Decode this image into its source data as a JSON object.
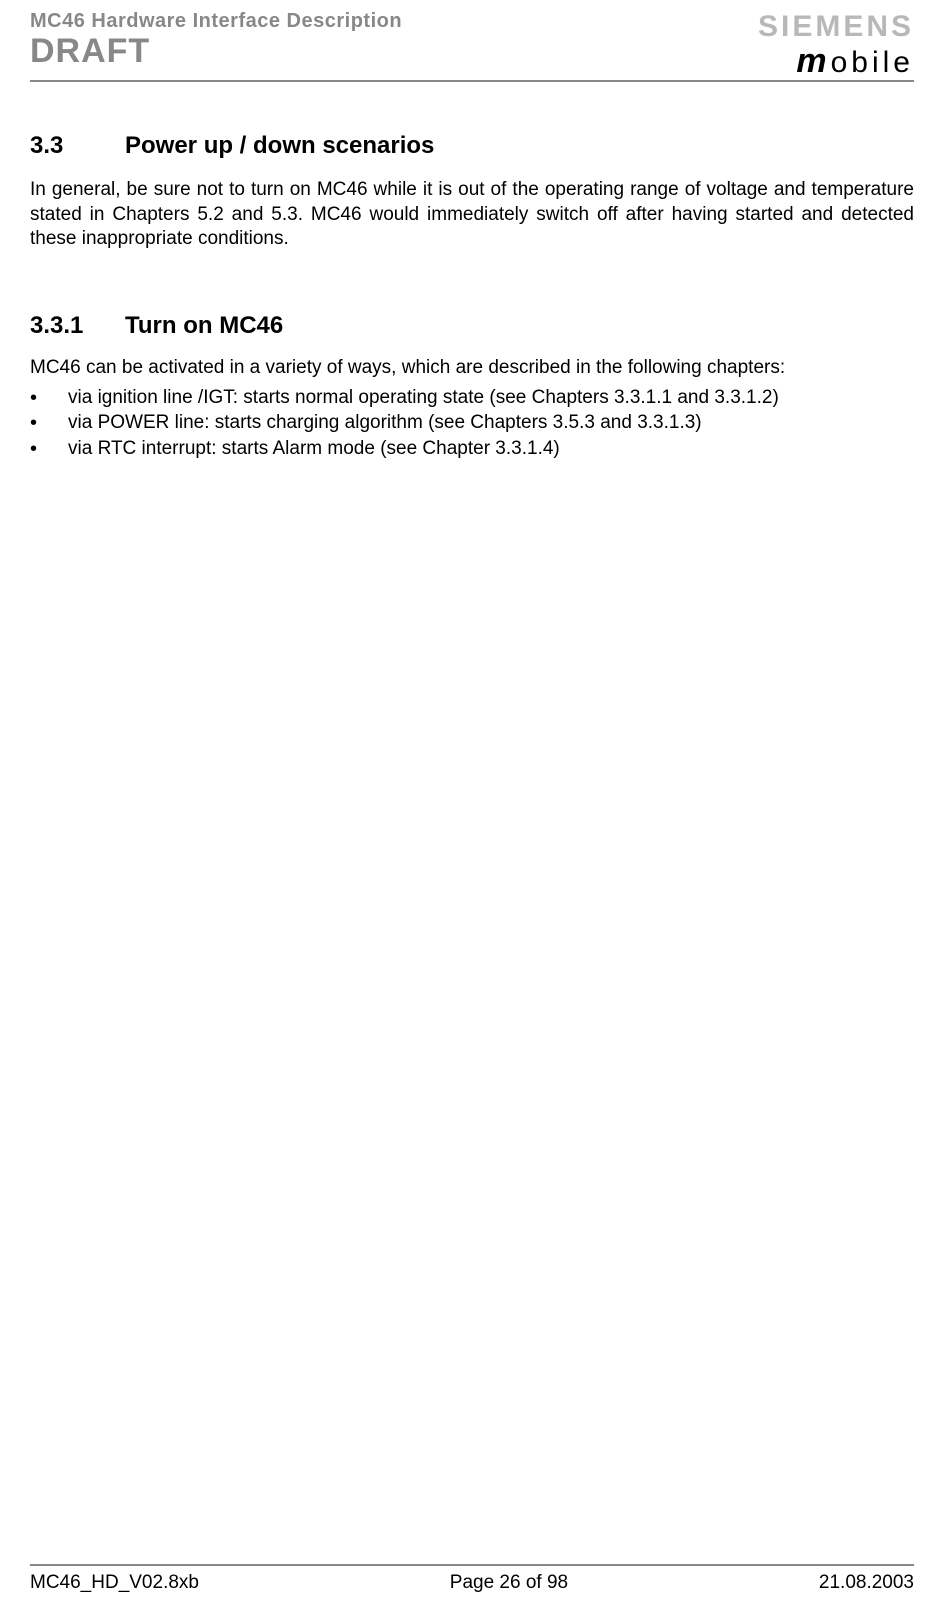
{
  "header": {
    "doc_title": "MC46 Hardware Interface Description",
    "draft": "DRAFT",
    "brand": "SIEMENS",
    "brand_sub_m": "m",
    "brand_sub_rest": "obile"
  },
  "section_3_3": {
    "num": "3.3",
    "title": "Power up / down scenarios",
    "body": "In general, be sure not to turn on MC46 while it is out of the operating range of voltage and temperature stated in Chapters 5.2 and 5.3. MC46 would immediately switch off after having started and detected these inappropriate conditions."
  },
  "section_3_3_1": {
    "num": "3.3.1",
    "title": "Turn on MC46",
    "intro": "MC46 can be activated in a variety of ways, which are described in the following chapters:",
    "bullets": [
      "via ignition line /IGT: starts normal operating state (see Chapters 3.3.1.1 and 3.3.1.2)",
      "via POWER line: starts charging algorithm (see Chapters 3.5.3 and 3.3.1.3)",
      "via RTC interrupt: starts Alarm mode (see Chapter 3.3.1.4)"
    ]
  },
  "footer": {
    "left": "MC46_HD_V02.8xb",
    "center": "Page 26 of 98",
    "right": "21.08.2003"
  }
}
